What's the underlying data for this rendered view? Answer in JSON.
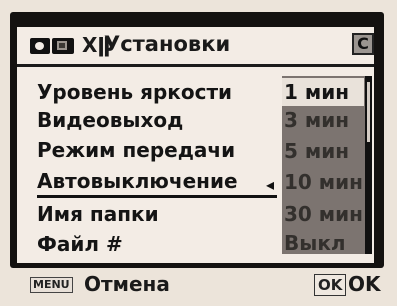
{
  "header": {
    "title": "Установки",
    "setup_icon": "Xǁ",
    "custom_tab": "C",
    "tabs_icons": [
      "camera-tab-icon",
      "playback-tab-icon",
      "setup-wrench-icon",
      "custom-tab-icon"
    ]
  },
  "menu": {
    "items": [
      {
        "label": "Уровень яркости"
      },
      {
        "label": "Видеовыход"
      },
      {
        "label": "Режим передачи"
      },
      {
        "label": "Автовыключение"
      },
      {
        "label": "Имя папки"
      },
      {
        "label": "Файл #"
      }
    ],
    "selected_index": 3,
    "arrow": "◂"
  },
  "options": {
    "items": [
      "1 мин",
      "3 мин",
      "5 мин",
      "10 мин",
      "30 мин",
      "Выкл"
    ],
    "highlighted_index": 0
  },
  "footer": {
    "menu_key": "MENU",
    "cancel_label": "Отмена",
    "ok_key": "OK",
    "ok_label": "OK"
  },
  "colors": {
    "panel": "#f3ece5",
    "frame": "#141210",
    "options_bg": "#7c7470",
    "highlight": "#e9e2da"
  }
}
